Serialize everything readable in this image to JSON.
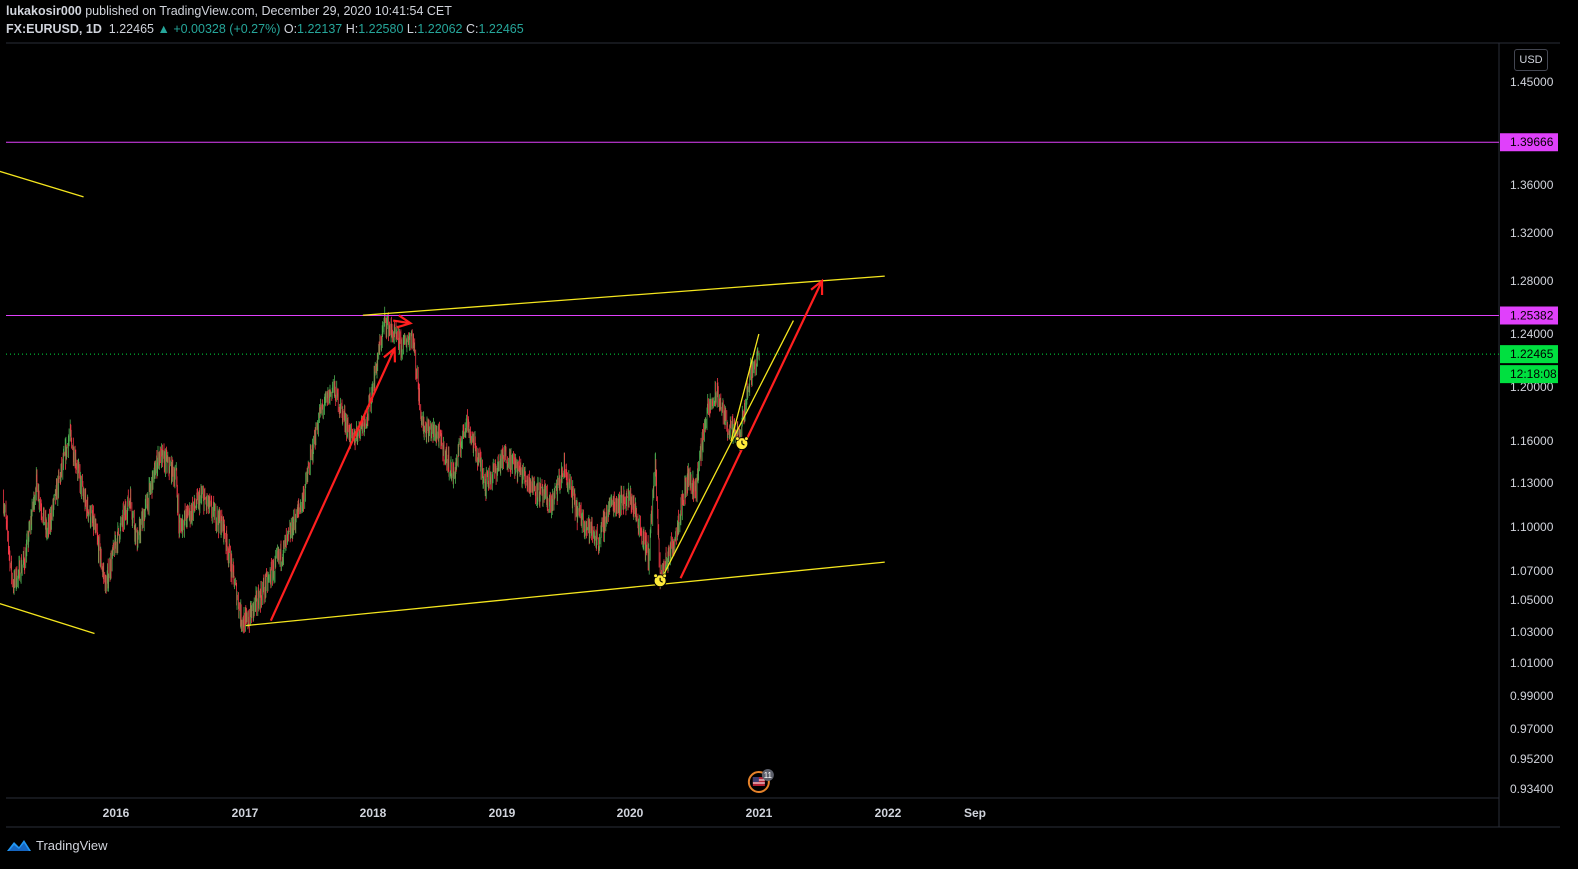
{
  "header": {
    "author": "lukakosir000",
    "published": " published on TradingView.com, December 29, 2020 10:41:54 CET",
    "symbol": "FX:EURUSD, 1D",
    "last": "1.22465",
    "change": "+0.00328 (+0.27%)",
    "o_label": "O:",
    "o_val": "1.22137",
    "h_label": "H:",
    "h_val": "1.22580",
    "l_label": "L:",
    "l_val": "1.22062",
    "c_label": "C:",
    "c_val": "1.22465"
  },
  "currency_button": "USD",
  "footer": {
    "brand": "TradingView"
  },
  "colors": {
    "up": "#26a69a",
    "candle_up": "#4caf50",
    "candle_down": "#f23645",
    "trendline": "#f5e61e",
    "level": "#e040fb",
    "arrow": "#ff1f1f",
    "current": "#00e040"
  },
  "chart_data": {
    "type": "candlestick",
    "symbol": "FX:EURUSD",
    "interval": "1D",
    "x_labels": [
      "2016",
      "2017",
      "2018",
      "2019",
      "2020",
      "2021",
      "2022",
      "Sep"
    ],
    "y_ticks": [
      "1.45000",
      "1.36000",
      "1.32000",
      "1.28000",
      "1.24000",
      "1.20000",
      "1.16000",
      "1.13000",
      "1.10000",
      "1.07000",
      "1.05000",
      "1.03000",
      "1.01000",
      "0.99000",
      "0.97000",
      "0.95200",
      "0.93400"
    ],
    "price_labels": [
      {
        "value": "1.39666",
        "kind": "level"
      },
      {
        "value": "1.25382",
        "kind": "level"
      },
      {
        "value": "1.22465",
        "kind": "current"
      },
      {
        "value": "12:18:08",
        "kind": "countdown"
      }
    ],
    "horizontal_levels": [
      1.39666,
      1.25382
    ],
    "current_price": 1.22465,
    "price_path": [
      {
        "date": "2015-02-15",
        "close": 1.12
      },
      {
        "date": "2015-03-15",
        "close": 1.06
      },
      {
        "date": "2015-04-20",
        "close": 1.08
      },
      {
        "date": "2015-05-20",
        "close": 1.13
      },
      {
        "date": "2015-06-20",
        "close": 1.095
      },
      {
        "date": "2015-08-24",
        "close": 1.165
      },
      {
        "date": "2015-10-01",
        "close": 1.12
      },
      {
        "date": "2015-11-01",
        "close": 1.1
      },
      {
        "date": "2015-12-03",
        "close": 1.06
      },
      {
        "date": "2016-01-01",
        "close": 1.09
      },
      {
        "date": "2016-02-10",
        "close": 1.12
      },
      {
        "date": "2016-03-01",
        "close": 1.09
      },
      {
        "date": "2016-05-03",
        "close": 1.15
      },
      {
        "date": "2016-06-20",
        "close": 1.135
      },
      {
        "date": "2016-06-27",
        "close": 1.1
      },
      {
        "date": "2016-09-01",
        "close": 1.12
      },
      {
        "date": "2016-11-01",
        "close": 1.1
      },
      {
        "date": "2016-12-20",
        "close": 1.04
      },
      {
        "date": "2017-01-03",
        "close": 1.035
      },
      {
        "date": "2017-03-01",
        "close": 1.06
      },
      {
        "date": "2017-05-01",
        "close": 1.09
      },
      {
        "date": "2017-06-15",
        "close": 1.12
      },
      {
        "date": "2017-08-01",
        "close": 1.18
      },
      {
        "date": "2017-09-08",
        "close": 1.2
      },
      {
        "date": "2017-11-01",
        "close": 1.16
      },
      {
        "date": "2017-12-15",
        "close": 1.18
      },
      {
        "date": "2018-02-01",
        "close": 1.25
      },
      {
        "date": "2018-03-20",
        "close": 1.23
      },
      {
        "date": "2018-04-20",
        "close": 1.24
      },
      {
        "date": "2018-05-20",
        "close": 1.17
      },
      {
        "date": "2018-07-01",
        "close": 1.165
      },
      {
        "date": "2018-08-15",
        "close": 1.135
      },
      {
        "date": "2018-09-20",
        "close": 1.175
      },
      {
        "date": "2018-11-15",
        "close": 1.13
      },
      {
        "date": "2019-01-10",
        "close": 1.15
      },
      {
        "date": "2019-03-20",
        "close": 1.13
      },
      {
        "date": "2019-05-20",
        "close": 1.115
      },
      {
        "date": "2019-06-25",
        "close": 1.14
      },
      {
        "date": "2019-08-01",
        "close": 1.11
      },
      {
        "date": "2019-10-01",
        "close": 1.09
      },
      {
        "date": "2019-11-01",
        "close": 1.115
      },
      {
        "date": "2019-12-31",
        "close": 1.12
      },
      {
        "date": "2020-02-20",
        "close": 1.08
      },
      {
        "date": "2020-03-09",
        "close": 1.145
      },
      {
        "date": "2020-03-23",
        "close": 1.065
      },
      {
        "date": "2020-05-01",
        "close": 1.09
      },
      {
        "date": "2020-06-10",
        "close": 1.135
      },
      {
        "date": "2020-07-01",
        "close": 1.125
      },
      {
        "date": "2020-08-01",
        "close": 1.18
      },
      {
        "date": "2020-09-01",
        "close": 1.195
      },
      {
        "date": "2020-10-01",
        "close": 1.17
      },
      {
        "date": "2020-11-04",
        "close": 1.162
      },
      {
        "date": "2020-12-04",
        "close": 1.21
      },
      {
        "date": "2020-12-29",
        "close": 1.2246
      }
    ],
    "trendlines": [
      {
        "from": {
          "date": "2017-01-03",
          "price": 1.034
        },
        "to": {
          "date": "2021-12-20",
          "price": 1.076
        }
      },
      {
        "from": {
          "date": "2017-12-01",
          "price": 1.254
        },
        "to": {
          "date": "2021-12-20",
          "price": 1.284
        }
      },
      {
        "from": {
          "date": "2015-02-01",
          "price": 1.048
        },
        "to": {
          "date": "2015-11-01",
          "price": 1.029
        }
      },
      {
        "from": {
          "date": "2015-02-01",
          "price": 1.372
        },
        "to": {
          "date": "2015-10-01",
          "price": 1.35
        }
      },
      {
        "from": {
          "date": "2020-04-01",
          "price": 1.067
        },
        "to": {
          "date": "2021-04-05",
          "price": 1.25
        }
      },
      {
        "from": {
          "date": "2020-10-10",
          "price": 1.16
        },
        "to": {
          "date": "2020-12-28",
          "price": 1.24
        }
      }
    ],
    "arrows": [
      {
        "from": {
          "date": "2017-03-15",
          "price": 1.037
        },
        "to": {
          "date": "2018-03-01",
          "price": 1.229
        }
      },
      {
        "from": {
          "date": "2018-02-25",
          "price": 1.25
        },
        "to": {
          "date": "2018-04-15",
          "price": 1.248
        }
      },
      {
        "from": {
          "date": "2020-05-20",
          "price": 1.065
        },
        "to": {
          "date": "2021-06-25",
          "price": 1.28
        }
      }
    ],
    "alerts": [
      {
        "date": "2020-03-23",
        "price": 1.066
      },
      {
        "date": "2020-11-10",
        "price": 1.161
      }
    ],
    "events_badge": {
      "date": "2020-12-28",
      "count": "11"
    }
  }
}
